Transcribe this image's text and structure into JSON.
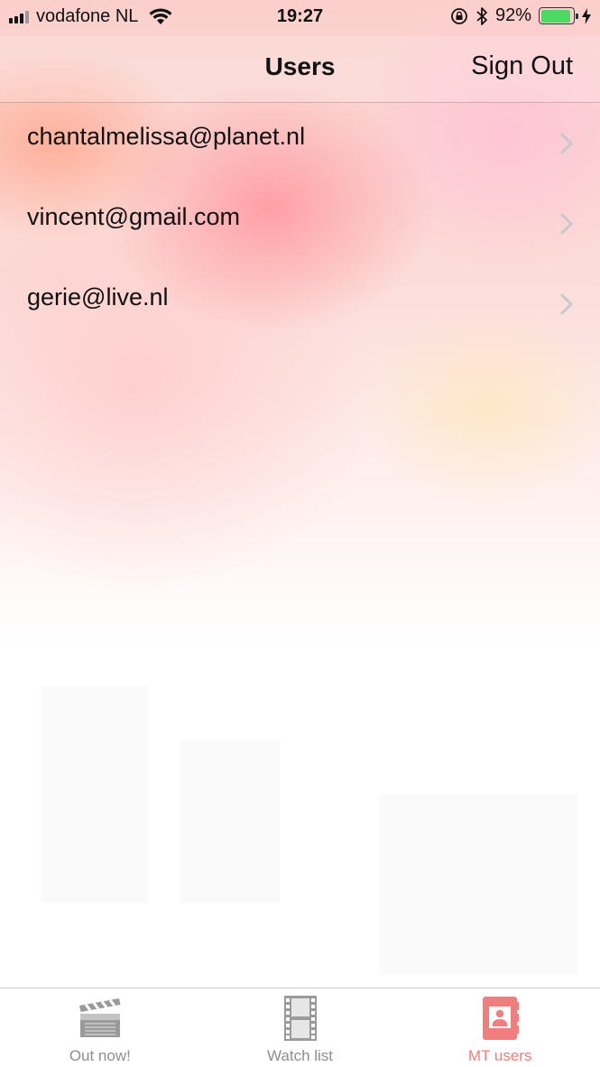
{
  "status_bar": {
    "carrier": "vodafone NL",
    "time": "19:27",
    "battery_percent": "92%",
    "battery_level": 0.92
  },
  "nav": {
    "title": "Users",
    "sign_out": "Sign Out"
  },
  "users": [
    {
      "email": "chantalmelissa@planet.nl"
    },
    {
      "email": "vincent@gmail.com"
    },
    {
      "email": "gerie@live.nl"
    }
  ],
  "tabs": [
    {
      "label": "Out now!",
      "icon": "clapperboard-icon",
      "active": false
    },
    {
      "label": "Watch list",
      "icon": "film-strip-icon",
      "active": false
    },
    {
      "label": "MT users",
      "icon": "contacts-book-icon",
      "active": true
    }
  ],
  "colors": {
    "accent": "#f07e7e",
    "inactive_tab": "#8e8e93",
    "battery": "#4cd964"
  }
}
